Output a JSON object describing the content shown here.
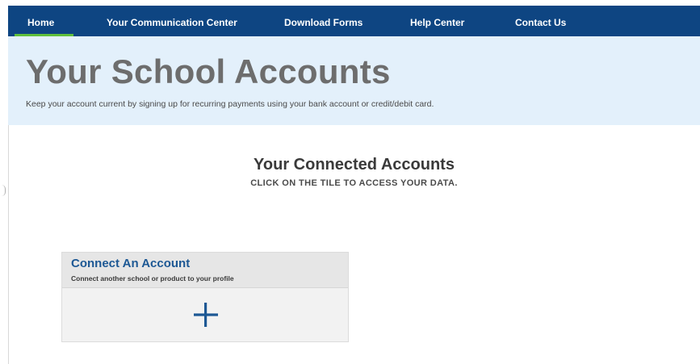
{
  "nav": {
    "items": [
      {
        "label": "Home",
        "active": true
      },
      {
        "label": "Your Communication Center",
        "active": false
      },
      {
        "label": "Download Forms",
        "active": false
      },
      {
        "label": "Help Center",
        "active": false
      },
      {
        "label": "Contact Us",
        "active": false
      }
    ]
  },
  "hero": {
    "title": "Your School Accounts",
    "subtitle": "Keep your account current by signing up for recurring payments using your bank account or credit/debit card."
  },
  "connected": {
    "title": "Your Connected Accounts",
    "instruction": "CLICK ON THE TILE TO ACCESS YOUR DATA."
  },
  "tile": {
    "title": "Connect An Account",
    "subtitle": "Connect another school or product to your profile",
    "icon": "plus-icon"
  },
  "colors": {
    "nav_background": "#0e4582",
    "nav_active_indicator": "#5fbf3b",
    "hero_background": "#e3f0fb",
    "tile_title": "#1d5894",
    "plus_icon": "#1d5894"
  }
}
